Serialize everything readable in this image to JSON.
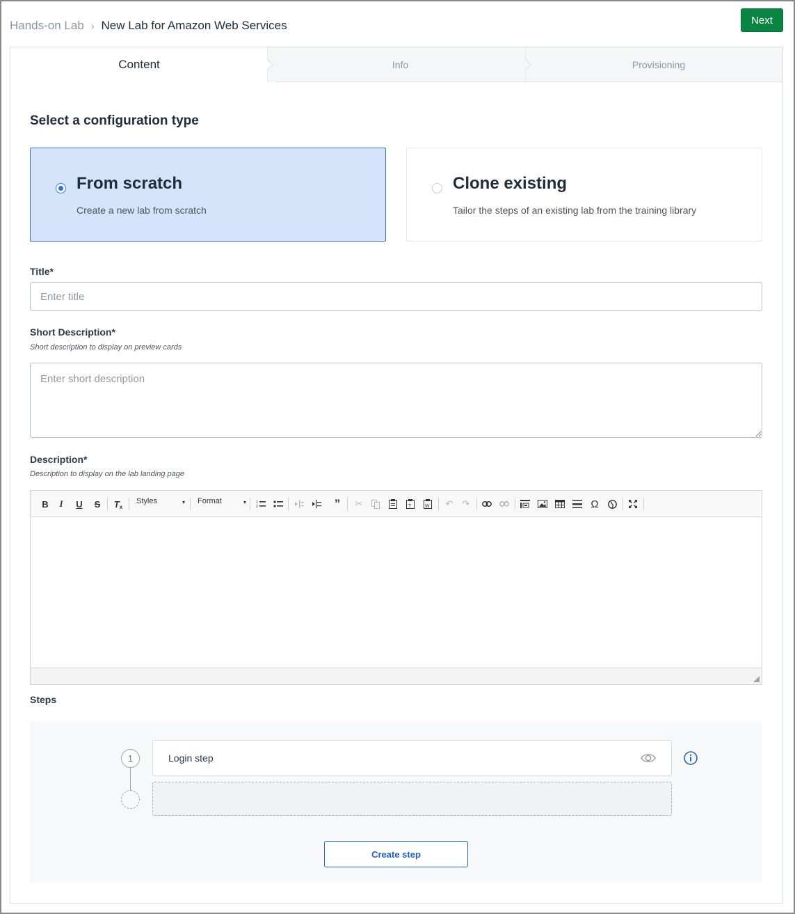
{
  "header": {
    "breadcrumb_root": "Hands-on Lab",
    "breadcrumb_current": "New Lab for Amazon Web Services",
    "next_label": "Next"
  },
  "tabs": [
    {
      "label": "Content",
      "active": true
    },
    {
      "label": "Info",
      "active": false
    },
    {
      "label": "Provisioning",
      "active": false
    }
  ],
  "config": {
    "heading": "Select a configuration type",
    "options": [
      {
        "title": "From scratch",
        "description": "Create a new lab from scratch",
        "selected": true
      },
      {
        "title": "Clone existing",
        "description": "Tailor the steps of an existing lab from the training library",
        "selected": false
      }
    ]
  },
  "form": {
    "title_label": "Title*",
    "title_placeholder": "Enter title",
    "short_desc_label": "Short Description*",
    "short_desc_hint": "Short description to display on preview cards",
    "short_desc_placeholder": "Enter short description",
    "desc_label": "Description*",
    "desc_hint": "Description to display on the lab landing page"
  },
  "editor": {
    "styles_label": "Styles",
    "format_label": "Format",
    "tools": [
      "bold-icon",
      "italic-icon",
      "underline-icon",
      "strikethrough-icon",
      "remove-format-icon",
      "numbered-list-icon",
      "bulleted-list-icon",
      "outdent-icon",
      "indent-icon",
      "blockquote-icon",
      "cut-icon",
      "copy-icon",
      "paste-icon",
      "paste-text-icon",
      "paste-word-icon",
      "undo-icon",
      "redo-icon",
      "link-icon",
      "unlink-icon",
      "anchor-icon",
      "image-icon",
      "table-icon",
      "horizontal-line-icon",
      "special-char-icon",
      "iframe-icon",
      "maximize-icon"
    ]
  },
  "steps": {
    "label": "Steps",
    "items": [
      {
        "number": "1",
        "title": "Login step"
      }
    ],
    "create_label": "Create step"
  },
  "colors": {
    "primary_green": "#0a8443",
    "selected_blue": "#d5e4fb",
    "link_blue": "#1f5fc0"
  }
}
